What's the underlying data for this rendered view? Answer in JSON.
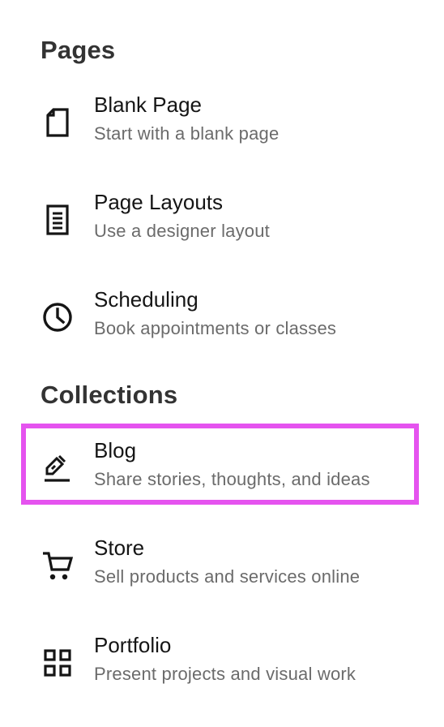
{
  "sections": [
    {
      "heading": "Pages",
      "items": [
        {
          "title": "Blank Page",
          "description": "Start with a blank page",
          "icon": "blank-page-icon"
        },
        {
          "title": "Page Layouts",
          "description": "Use a designer layout",
          "icon": "page-layouts-icon"
        },
        {
          "title": "Scheduling",
          "description": "Book appointments or classes",
          "icon": "clock-icon"
        }
      ]
    },
    {
      "heading": "Collections",
      "items": [
        {
          "title": "Blog",
          "description": "Share stories, thoughts, and ideas",
          "icon": "pen-icon",
          "selected": true
        },
        {
          "title": "Store",
          "description": "Sell products and services online",
          "icon": "cart-icon"
        },
        {
          "title": "Portfolio",
          "description": "Present projects and visual work",
          "icon": "grid-icon"
        }
      ]
    }
  ],
  "colors": {
    "highlight": "#e553ef",
    "heading": "#333333",
    "title": "#151515",
    "description": "#6b6b6b"
  }
}
